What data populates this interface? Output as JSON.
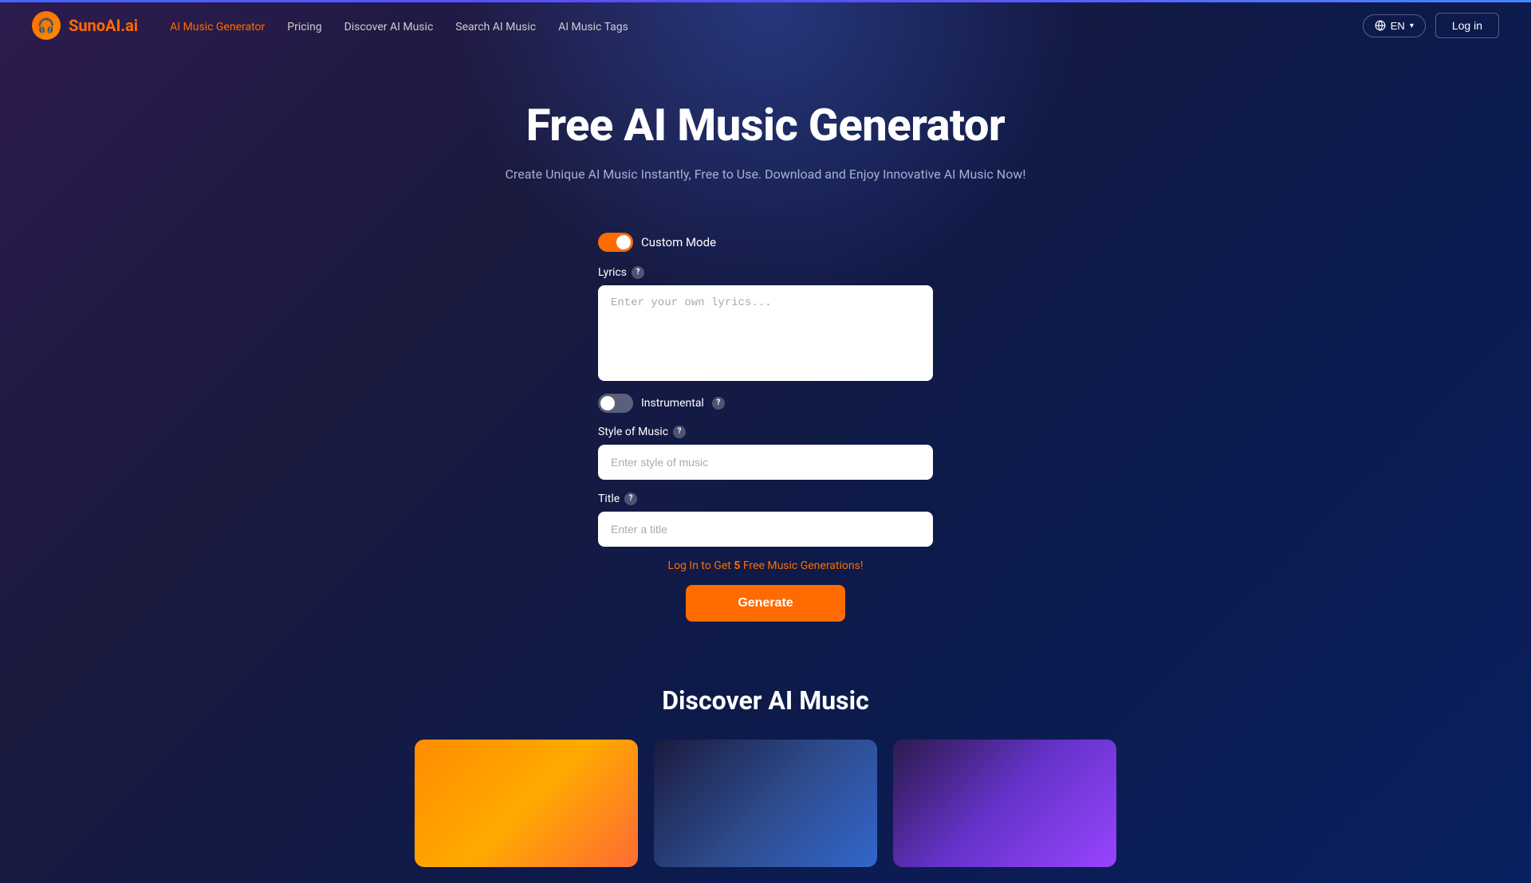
{
  "brand": {
    "name": "SunoAI.ai",
    "name_part1": "Suno",
    "name_part2": "AI.ai"
  },
  "navbar": {
    "logo_icon": "🎧",
    "nav_items": [
      {
        "label": "AI Music Generator",
        "active": true
      },
      {
        "label": "Pricing",
        "active": false
      },
      {
        "label": "Discover AI Music",
        "active": false
      },
      {
        "label": "Search AI Music",
        "active": false
      },
      {
        "label": "AI Music Tags",
        "active": false
      }
    ],
    "lang_label": "EN",
    "login_label": "Log in"
  },
  "hero": {
    "title": "Free AI Music Generator",
    "subtitle": "Create Unique AI Music Instantly, Free to Use. Download and Enjoy Innovative AI Music Now!"
  },
  "form": {
    "custom_mode_label": "Custom Mode",
    "custom_mode_on": true,
    "lyrics_label": "Lyrics",
    "lyrics_placeholder": "Enter your own lyrics...",
    "instrumental_label": "Instrumental",
    "instrumental_on": false,
    "style_label": "Style of Music",
    "style_placeholder": "Enter style of music",
    "title_label": "Title",
    "title_placeholder": "Enter a title",
    "login_prompt_text": "Log In to Get ",
    "login_prompt_count": "5",
    "login_prompt_suffix": " Free Music Generations!",
    "generate_label": "Generate"
  },
  "discover": {
    "title": "Discover AI Music"
  }
}
